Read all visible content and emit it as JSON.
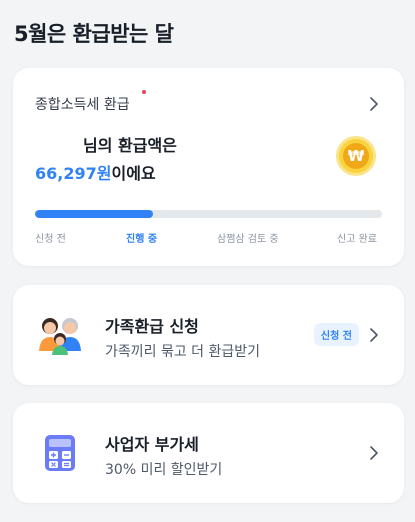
{
  "page": {
    "title": "5월은 환급받는 달"
  },
  "tax_card": {
    "title": "종합소득세 환급",
    "name_line": "님의 환급액은",
    "amount": "66,297원",
    "amount_suffix": "이에요",
    "coin_symbol": "₩",
    "progress": 0.34,
    "steps": [
      "신청 전",
      "진행 중",
      "삼쩜삼 검토 중",
      "신고 완료"
    ],
    "active_step": 1
  },
  "family_card": {
    "title": "가족환급 신청",
    "subtitle": "가족끼리 묶고 더 환급받기",
    "badge": "신청 전",
    "icon": "family-icon"
  },
  "vat_card": {
    "title": "사업자 부가세",
    "subtitle": "30% 미리 할인받기",
    "icon": "calculator-icon"
  },
  "colors": {
    "accent": "#3182f6",
    "background": "#f2f4f6",
    "coin": "#f8d33e",
    "dot": "#f04452"
  }
}
